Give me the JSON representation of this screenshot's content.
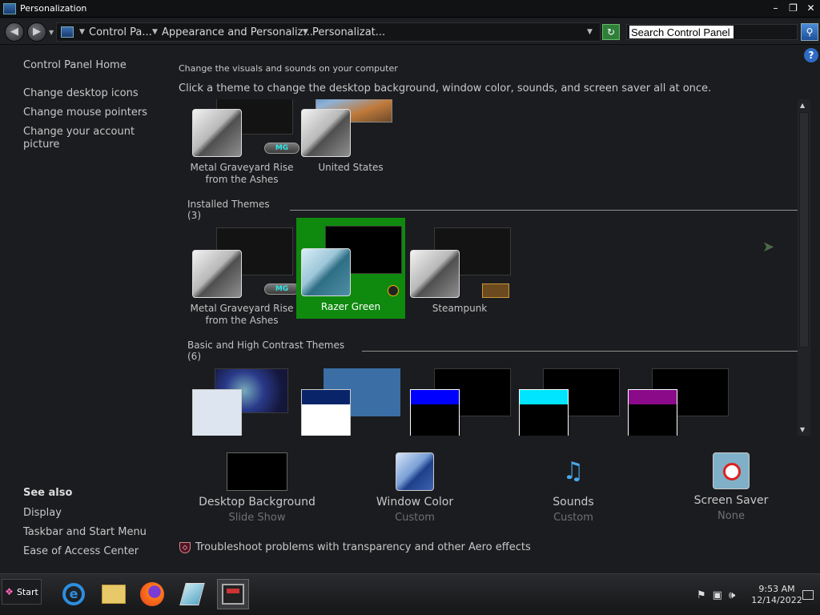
{
  "window": {
    "title": "Personalization",
    "minimize": "–",
    "maximize": "❐",
    "close": "✕"
  },
  "address": {
    "breadcrumbs": [
      "Control Pa...",
      "Appearance and Personaliz...",
      "Personalizat..."
    ],
    "search_placeholder": "Search Control Panel"
  },
  "sidebar": {
    "home": "Control Panel Home",
    "links": [
      "Change desktop icons",
      "Change mouse pointers",
      "Change your account",
      "picture"
    ],
    "see_also_title": "See also",
    "see_also": [
      "Display",
      "Taskbar and Start Menu",
      "Ease of Access Center"
    ]
  },
  "main": {
    "intro_small": "Change the visuals and sounds on your computer",
    "intro": "Click a theme to change the desktop background, window color, sounds, and screen saver all at once.",
    "my_themes": [
      {
        "name_line1": "Metal Graveyard Rise",
        "name_line2": "from the Ashes",
        "badge": "MG"
      },
      {
        "name_line1": "United States",
        "name_line2": ""
      }
    ],
    "installed_header": "Installed Themes (3)",
    "installed_themes": [
      {
        "name_line1": "Metal Graveyard Rise",
        "name_line2": "from the Ashes",
        "badge": "MG"
      },
      {
        "name_line1": "Razer Green",
        "name_line2": "",
        "selected": true
      },
      {
        "name_line1": "Steampunk",
        "name_line2": ""
      }
    ],
    "basic_header": "Basic and High Contrast Themes (6)"
  },
  "bottom": {
    "desktop_background": {
      "name": "Desktop Background",
      "value": "Slide Show"
    },
    "window_color": {
      "name": "Window Color",
      "value": "Custom"
    },
    "sounds": {
      "name": "Sounds",
      "value": "Custom"
    },
    "screen_saver": {
      "name": "Screen Saver",
      "value": "None"
    },
    "troubleshoot": "Troubleshoot problems with transparency and other Aero effects"
  },
  "taskbar": {
    "start": "Start",
    "time": "9:53 AM",
    "date": "12/14/2022"
  },
  "colors": {
    "selected_theme": "#0f8a0f",
    "background": "#1b1c1f"
  }
}
